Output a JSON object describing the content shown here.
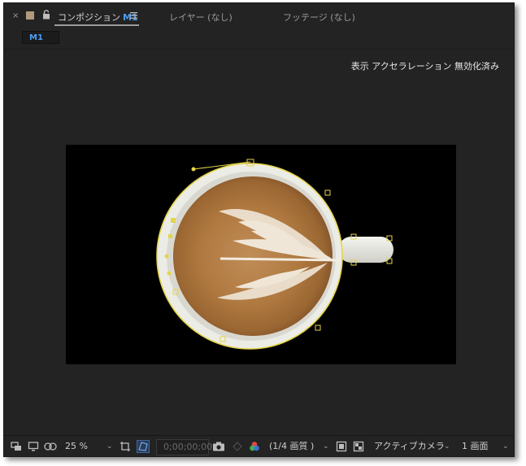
{
  "tabs": {
    "close": "×",
    "active_label": "コンポジション",
    "active_name": "M1",
    "layer": "レイヤー (なし)",
    "footage": "フッテージ (なし)"
  },
  "subbar": {
    "chip": "M1"
  },
  "viewer": {
    "acceleration_notice": "表示 アクセラレーション 無効化済み"
  },
  "footer": {
    "zoom": "25 %",
    "timecode": "0;00;00;00",
    "resolution": "(1/4 画質 )",
    "camera": "アクティブカメラ",
    "views": "1 画面"
  },
  "colors": {
    "panel": "#232323",
    "accent_blue": "#4c9df2",
    "label_swatch": "#b29a7c",
    "mask_yellow": "#e3d44a"
  },
  "icons": [
    "close-icon",
    "label-color-swatch",
    "lock-icon",
    "panel-menu-icon",
    "snapshot-icon",
    "camera-icon"
  ]
}
